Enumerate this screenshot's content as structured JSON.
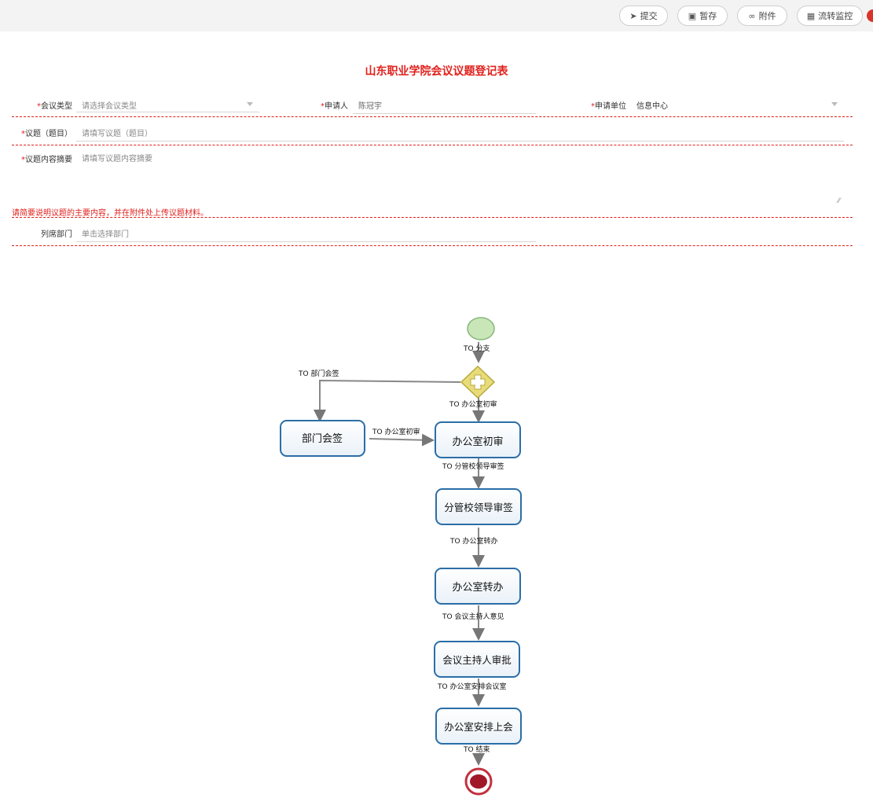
{
  "toolbar": {
    "submit_icon": "send-icon",
    "submit_label": "提交",
    "save_icon": "save-icon",
    "save_label": "暂存",
    "attach_icon": "attachment-icon",
    "attach_label": "附件",
    "monitor_icon": "grid-icon",
    "monitor_label": "流转监控"
  },
  "form": {
    "title": "山东职业学院会议议题登记表",
    "meeting_type": {
      "required_mark": "*",
      "label": "会议类型",
      "placeholder": "请选择会议类型"
    },
    "applicant": {
      "required_mark": "*",
      "label": "申请人",
      "value": "陈冠宇"
    },
    "unit": {
      "required_mark": "*",
      "label": "申请单位",
      "value": "信息中心"
    },
    "topic": {
      "required_mark": "*",
      "label": "议题（题目）",
      "placeholder": "请填写议题（题目）"
    },
    "summary": {
      "required_mark": "*",
      "label": "议题内容摘要",
      "placeholder": "请填写议题内容摘要"
    },
    "hint": "请简要说明议题的主要内容，并在附件处上传议题材料。",
    "attend_dept": {
      "label": "列席部门",
      "placeholder": "单击选择部门"
    }
  },
  "flow": {
    "nodes": {
      "dept_sign": "部门会签",
      "office_review": "办公室初审",
      "leader_sign": "分管校领导审签",
      "office_transfer": "办公室转办",
      "host_approve": "会议主持人审批",
      "office_arrange": "办公室安排上会"
    },
    "edges": {
      "to_branch": "TO 分支",
      "to_dept_sign": "TO 部门会签",
      "to_office_review_1": "TO 办公室初审",
      "to_office_review_2": "TO 办公室初审",
      "to_leader_sign": "TO 分管校领导审签",
      "to_office_transfer": "TO 办公室转办",
      "to_host_opinion": "TO 会议主持人意见",
      "to_office_arrange": "TO 办公室安排会议室",
      "to_end": "TO 结束"
    },
    "colors": {
      "task_border": "#2b6ea6",
      "start_fill": "#c8e6b8",
      "gateway_fill": "#e8dc7a",
      "end_fill": "#a01828"
    }
  }
}
